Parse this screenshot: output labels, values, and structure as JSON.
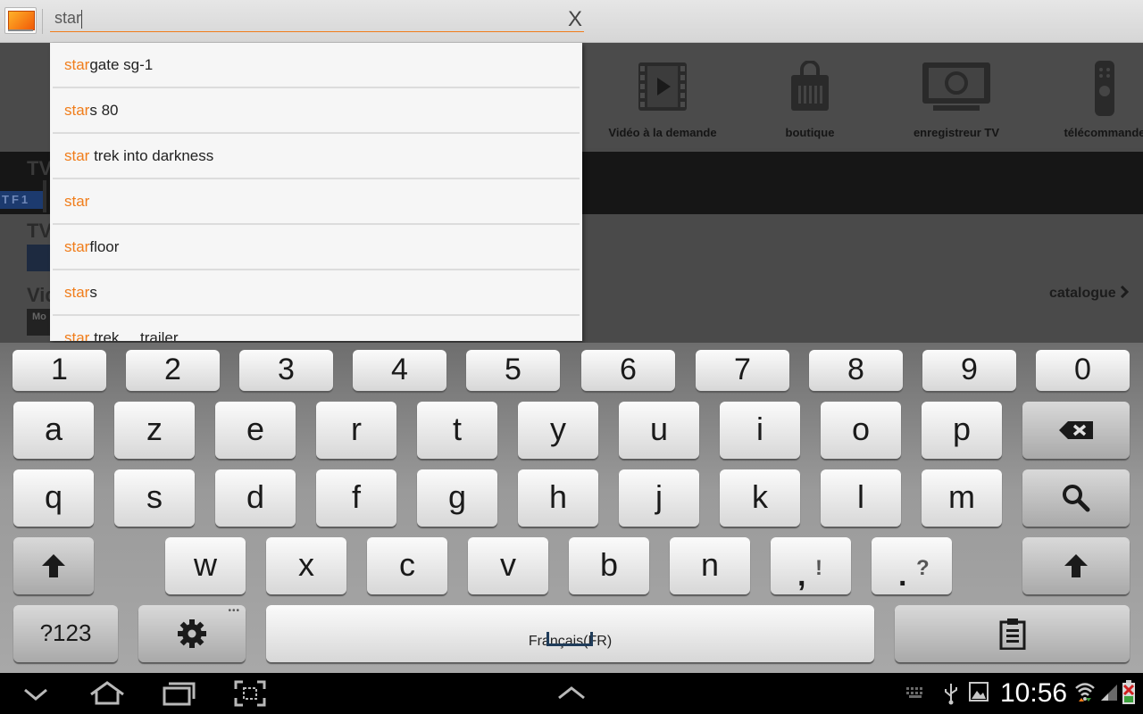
{
  "search": {
    "value": "star",
    "clear_label": "X"
  },
  "suggestions": [
    {
      "match": "star",
      "rest": "gate sg-1"
    },
    {
      "match": "star",
      "rest": "s 80"
    },
    {
      "match": "star",
      "rest": " trek into darkness"
    },
    {
      "match": "star",
      "rest": ""
    },
    {
      "match": "star",
      "rest": "floor"
    },
    {
      "match": "star",
      "rest": "s"
    },
    {
      "match": "star",
      "rest": " trek ... trailer"
    }
  ],
  "quick_access": [
    {
      "label": "Vidéo à la demande",
      "icon": "video-icon"
    },
    {
      "label": "boutique",
      "icon": "shopping-bag-icon"
    },
    {
      "label": "enregistreur TV",
      "icon": "tv-recorder-icon"
    },
    {
      "label": "télécommande",
      "icon": "remote-control-icon"
    }
  ],
  "background": {
    "section_tv": "TV",
    "tv_logo": "TF1",
    "section_tv2": "TV",
    "section_video": "Vid",
    "thumb_text": "Mo",
    "catalogue_link": "catalogue"
  },
  "keyboard": {
    "numbers": [
      "1",
      "2",
      "3",
      "4",
      "5",
      "6",
      "7",
      "8",
      "9",
      "0"
    ],
    "row1": [
      "a",
      "z",
      "e",
      "r",
      "t",
      "y",
      "u",
      "i",
      "o",
      "p"
    ],
    "row2": [
      "q",
      "s",
      "d",
      "f",
      "g",
      "h",
      "j",
      "k",
      "l",
      "m"
    ],
    "row3": [
      "w",
      "x",
      "c",
      "v",
      "b",
      "n"
    ],
    "comma_key": {
      "main": ",",
      "sub": "!"
    },
    "period_key": {
      "main": ".",
      "sub": "?"
    },
    "symbols_label": "?123",
    "language_label": "Français(FR)",
    "settings_dots": "•••"
  },
  "status": {
    "time": "10:56"
  },
  "colors": {
    "accent": "#f07d1b",
    "keyboard_bg": "#9a9a9a",
    "navbar_bg": "#000000"
  }
}
